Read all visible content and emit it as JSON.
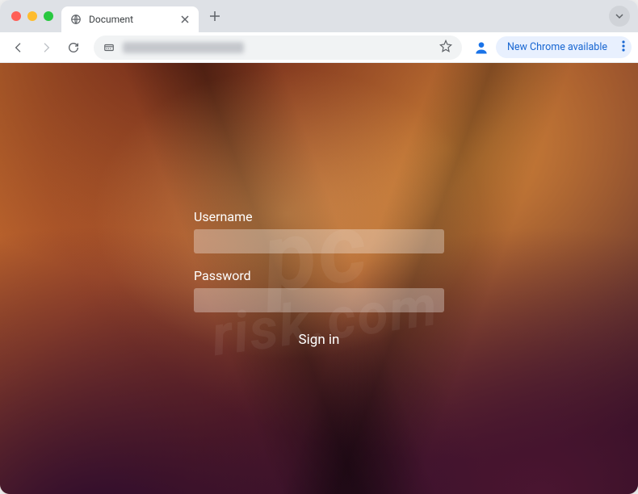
{
  "browser": {
    "tab_title": "Document",
    "update_chip": "New Chrome available"
  },
  "login": {
    "username_label": "Username",
    "password_label": "Password",
    "signin_label": "Sign in"
  },
  "watermark": {
    "line1": "pc",
    "line2": "risk.com"
  }
}
